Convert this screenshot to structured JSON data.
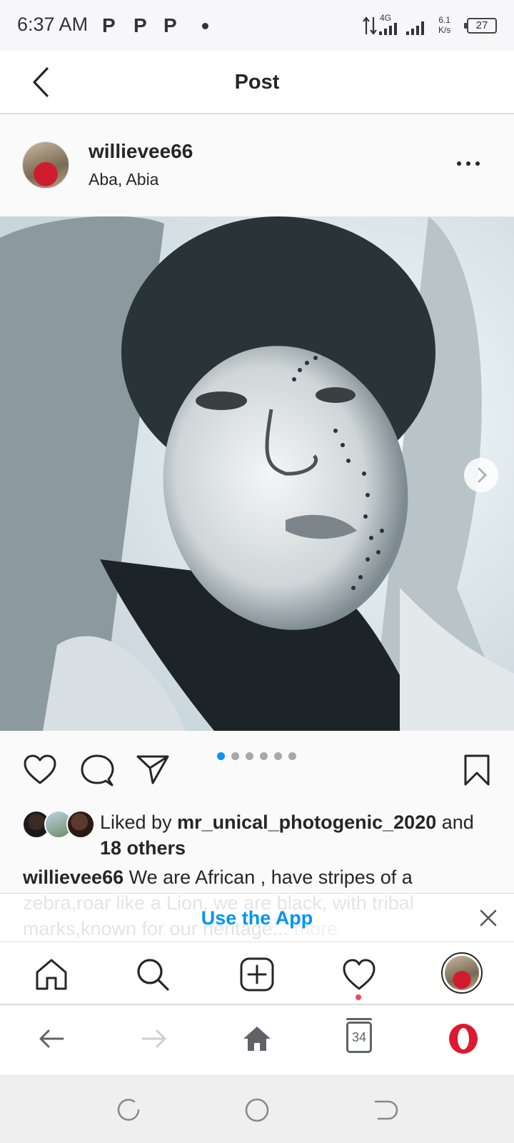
{
  "status_bar": {
    "time": "6:37 AM",
    "notification_icons": [
      "P",
      "P",
      "P"
    ],
    "network_type": "4G",
    "net_speed_value": "6.1",
    "net_speed_unit": "K/s",
    "battery": "27"
  },
  "header": {
    "title": "Post",
    "back_icon": "chevron-left-icon"
  },
  "post": {
    "username": "willievee66",
    "location": "Aba, Abia",
    "more_icon": "more-horizontal-icon",
    "photo_description_icon": "portrait-photo",
    "carousel": {
      "count": 6,
      "active_index": 0
    },
    "likes": {
      "prefix": "Liked by",
      "user": "mr_unical_photogenic_2020",
      "conjunction": "and",
      "others": "18 others"
    },
    "caption": {
      "username": "willievee66",
      "text": "We are African , have stripes of a zebra,roar like a Lion, we are black, with tribal marks,known for our heritage...",
      "more_label": "more"
    }
  },
  "banner": {
    "label": "Use the App"
  },
  "bottom_nav": {
    "items": [
      "home-icon",
      "search-icon",
      "new-post-icon",
      "activity-heart-icon",
      "profile-avatar"
    ],
    "notification_color": "#ed4956"
  },
  "browser_bar": {
    "tab_count": "34",
    "brand_color": "#e0182f"
  },
  "colors": {
    "accent": "#0095f6",
    "text": "#262626",
    "muted": "#8e8e8e"
  }
}
